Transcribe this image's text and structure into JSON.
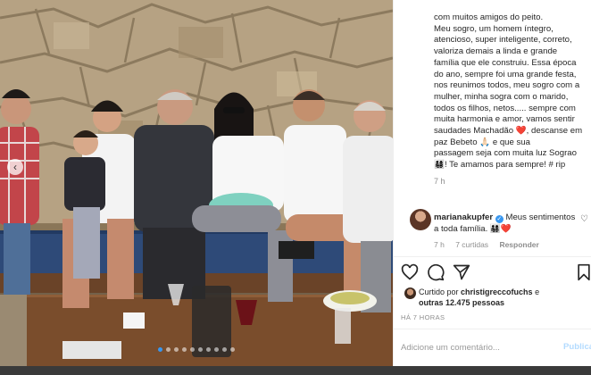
{
  "post": {
    "caption_lines": "com muitos amigos do peito.\nMeu sogro, um homem íntegro,\natencioso, super inteligente, correto,\nvaloriza demais a linda e grande\nfamília que ele construiu. Essa época\ndo ano, sempre foi uma grande festa,\nnos reunimos todos, meu sogro com a\nmulher, minha sogra com o marido,\ntodos os filhos, netos..... sempre com\nmuita harmonia e amor, vamos sentir\nsaudades Machadão ❤️, descanse em\npaz Bebeto 🙏🏻 e que sua\npassagem seja com muita luz Sograo\n👨‍👩‍👧‍👦! Te amamos para sempre! # rip",
    "caption_time": "7 h"
  },
  "comment": {
    "username": "marianakupfer",
    "verified_mark": "✓",
    "text": "Meus sentimentos a toda família. 👨‍👩‍👧‍👦❤️",
    "time": "7 h",
    "likes": "7 curtidas",
    "reply": "Responder",
    "like_icon": "♡"
  },
  "actions": {
    "like_icon": "heart-icon",
    "comment_icon": "comment-icon",
    "share_icon": "share-icon",
    "save_icon": "bookmark-icon"
  },
  "likes": {
    "prefix": "Curtido por ",
    "user": "christigreccofuchs",
    "middle": " e",
    "others": "outras 12.475 pessoas"
  },
  "timeago": "HÁ 7 HORAS",
  "comment_box": {
    "placeholder": "Adicione um comentário...",
    "publish": "Publicar"
  },
  "carousel": {
    "count": 10,
    "active_index": 0,
    "prev_arrow": "‹"
  },
  "colors": {
    "link_blue": "#3897f0",
    "publish_disabled": "#b3dbff",
    "muted_text": "#8e8e8e"
  }
}
